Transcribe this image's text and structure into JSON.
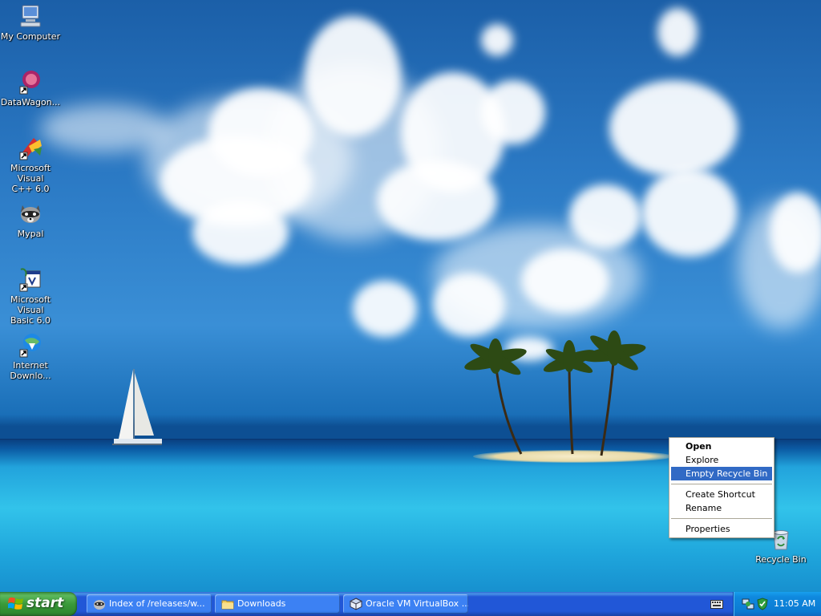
{
  "desktop": {
    "icons": [
      {
        "name": "My Computer",
        "icon": "my-computer-icon"
      },
      {
        "name": "DataWagon...",
        "icon": "datawagon-icon"
      },
      {
        "name": "Microsoft Visual C++ 6.0",
        "line1": "Microsoft Visual",
        "line2": "C++ 6.0",
        "icon": "visual-cpp-icon"
      },
      {
        "name": "Mypal",
        "icon": "mypal-raccoon-icon"
      },
      {
        "name": "Microsoft Visual Basic 6.0",
        "line1": "Microsoft Visual",
        "line2": "Basic 6.0",
        "icon": "visual-basic-icon"
      },
      {
        "name": "Internet Downlo...",
        "line1": "Internet",
        "line2": "Downlo...",
        "icon": "internet-download-manager-icon"
      },
      {
        "name": "Recycle Bin",
        "icon": "recycle-bin-icon"
      }
    ]
  },
  "context_menu": {
    "items": [
      {
        "label": "Open",
        "bold": true
      },
      {
        "label": "Explore"
      },
      {
        "label": "Empty Recycle Bin",
        "highlighted": true
      },
      {
        "label": "Create Shortcut"
      },
      {
        "label": "Rename"
      },
      {
        "label": "Properties"
      }
    ]
  },
  "taskbar": {
    "start_label": "start",
    "buttons": [
      {
        "label": "Index of /releases/w...",
        "icon": "mypal-raccoon-icon"
      },
      {
        "label": "Downloads",
        "icon": "folder-icon"
      },
      {
        "label": "Oracle VM VirtualBox ...",
        "icon": "virtualbox-icon"
      }
    ],
    "tray": {
      "clock": "11:05 AM",
      "icons": [
        "network-icon",
        "security-shield-icon"
      ]
    }
  },
  "colors": {
    "taskbar_blue": "#2157d7",
    "start_green": "#3a9a3a",
    "tray_blue": "#0c7bd3",
    "menu_highlight": "#316ac5"
  }
}
